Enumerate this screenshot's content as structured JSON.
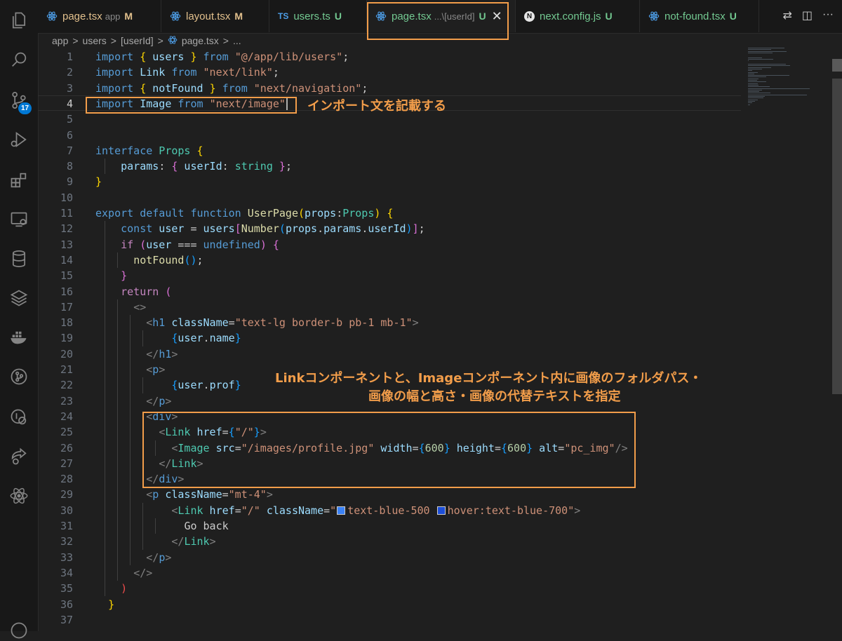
{
  "tabs": [
    {
      "label": "page.tsx",
      "desc": "app",
      "status": "M",
      "icon": "react-icon"
    },
    {
      "label": "layout.tsx",
      "desc": "",
      "status": "M",
      "icon": "react-icon"
    },
    {
      "label": "users.ts",
      "desc": "",
      "status": "U",
      "icon": "typescript-icon",
      "icon_text": "TS"
    },
    {
      "label": "page.tsx",
      "desc": "...\\[userId]",
      "status": "U",
      "icon": "react-icon",
      "active": true,
      "close": "✕"
    },
    {
      "label": "next.config.js",
      "desc": "",
      "status": "U",
      "icon": "nextjs-icon",
      "icon_text": "N"
    },
    {
      "label": "not-found.tsx",
      "desc": "",
      "status": "U",
      "icon": "react-icon"
    }
  ],
  "tab_actions": {
    "compare": "⇄",
    "split": "◫",
    "more": "···"
  },
  "breadcrumb": {
    "seg1": "app",
    "seg2": "users",
    "seg3": "[userId]",
    "file": "page.tsx",
    "tail": "...",
    "sep": ">"
  },
  "activity": {
    "scm_badge": "17"
  },
  "annotations": {
    "import_note": "インポート文を記載する",
    "link_note_1": "Linkコンポーネントと、Imageコンポーネント内に画像のフォルダパス・",
    "link_note_2": "画像の幅と高さ・画像の代替テキストを指定"
  },
  "lines": [
    [
      [
        "kw",
        "import"
      ],
      [
        "",
        "&nbsp;"
      ],
      [
        "br1",
        "{"
      ],
      [
        "id",
        " users "
      ],
      [
        "br1",
        "}"
      ],
      [
        "kw",
        " from "
      ],
      [
        "str",
        "\"@/app/lib/users\""
      ],
      [
        "",
        ";"
      ]
    ],
    [
      [
        "kw",
        "import"
      ],
      [
        "id",
        " Link"
      ],
      [
        "kw",
        " from "
      ],
      [
        "str",
        "\"next/link\""
      ],
      [
        "",
        ";"
      ]
    ],
    [
      [
        "kw",
        "import"
      ],
      [
        "",
        "&nbsp;"
      ],
      [
        "br1",
        "{"
      ],
      [
        "id",
        " notFound "
      ],
      [
        "br1",
        "}"
      ],
      [
        "kw",
        " from "
      ],
      [
        "str",
        "\"next/navigation\""
      ],
      [
        "",
        ";"
      ]
    ],
    [
      [
        "kw",
        "import"
      ],
      [
        "id",
        " Image"
      ],
      [
        "kw",
        " from "
      ],
      [
        "str",
        "\"next/image\""
      ]
    ],
    [],
    [],
    [
      [
        "kw",
        "interface"
      ],
      [
        "ty",
        " Props"
      ],
      [
        "br1",
        " {"
      ]
    ],
    [
      [
        "",
        "    "
      ],
      [
        "id",
        "params"
      ],
      [
        "",
        ": "
      ],
      [
        "br2",
        "{"
      ],
      [
        "id",
        " userId"
      ],
      [
        "",
        ": "
      ],
      [
        "ty",
        "string"
      ],
      [
        "br2",
        " }"
      ],
      [
        "",
        ";"
      ]
    ],
    [
      [
        "br1",
        "}"
      ]
    ],
    [],
    [
      [
        "kw",
        "export"
      ],
      [
        "kw",
        " default"
      ],
      [
        "kw",
        " function"
      ],
      [
        "fn",
        " UserPage"
      ],
      [
        "br1",
        "("
      ],
      [
        "id",
        "props"
      ],
      [
        "",
        ":"
      ],
      [
        "ty",
        "Props"
      ],
      [
        "br1",
        ")"
      ],
      [
        "br1",
        " {"
      ]
    ],
    [
      [
        "",
        "    "
      ],
      [
        "kw",
        "const"
      ],
      [
        "id",
        " user"
      ],
      [
        "",
        " = "
      ],
      [
        "id",
        "users"
      ],
      [
        "br2",
        "["
      ],
      [
        "fn",
        "Number"
      ],
      [
        "br3",
        "("
      ],
      [
        "id",
        "props"
      ],
      [
        "",
        "."
      ],
      [
        "id",
        "params"
      ],
      [
        "",
        "."
      ],
      [
        "id",
        "userId"
      ],
      [
        "br3",
        ")"
      ],
      [
        "br2",
        "]"
      ],
      [
        "",
        ";"
      ]
    ],
    [
      [
        "",
        "    "
      ],
      [
        "ctl",
        "if"
      ],
      [
        "br2",
        " ("
      ],
      [
        "id",
        "user"
      ],
      [
        "",
        " === "
      ],
      [
        "kw",
        "undefined"
      ],
      [
        "br2",
        ")"
      ],
      [
        "br2",
        " {"
      ]
    ],
    [
      [
        "",
        "      "
      ],
      [
        "fn",
        "notFound"
      ],
      [
        "br3",
        "()"
      ],
      [
        "",
        ";"
      ]
    ],
    [
      [
        "",
        "    "
      ],
      [
        "br2",
        "}"
      ]
    ],
    [
      [
        "",
        "    "
      ],
      [
        "ctl",
        "return"
      ],
      [
        "br2",
        " ("
      ]
    ],
    [
      [
        "",
        "      "
      ],
      [
        "pn",
        "<>"
      ]
    ],
    [
      [
        "",
        "        "
      ],
      [
        "pn",
        "<"
      ],
      [
        "kw",
        "h1"
      ],
      [
        "attr",
        " className"
      ],
      [
        "",
        "="
      ],
      [
        "str",
        "\"text-lg border-b pb-1 mb-1\""
      ],
      [
        "pn",
        ">"
      ]
    ],
    [
      [
        "",
        "            "
      ],
      [
        "br3",
        "{"
      ],
      [
        "id",
        "user"
      ],
      [
        "",
        "."
      ],
      [
        "id",
        "name"
      ],
      [
        "br3",
        "}"
      ]
    ],
    [
      [
        "",
        "        "
      ],
      [
        "pn",
        "</"
      ],
      [
        "kw",
        "h1"
      ],
      [
        "pn",
        ">"
      ]
    ],
    [
      [
        "",
        "        "
      ],
      [
        "pn",
        "<"
      ],
      [
        "kw",
        "p"
      ],
      [
        "pn",
        ">"
      ]
    ],
    [
      [
        "",
        "            "
      ],
      [
        "br3",
        "{"
      ],
      [
        "id",
        "user"
      ],
      [
        "",
        "."
      ],
      [
        "id",
        "prof"
      ],
      [
        "br3",
        "}"
      ]
    ],
    [
      [
        "",
        "        "
      ],
      [
        "pn",
        "</"
      ],
      [
        "kw",
        "p"
      ],
      [
        "pn",
        ">"
      ]
    ],
    [
      [
        "",
        "        "
      ],
      [
        "pn",
        "<"
      ],
      [
        "kw",
        "div"
      ],
      [
        "pn",
        ">"
      ]
    ],
    [
      [
        "",
        "          "
      ],
      [
        "pn",
        "<"
      ],
      [
        "tag",
        "Link"
      ],
      [
        "attr",
        " href"
      ],
      [
        "",
        "="
      ],
      [
        "br3",
        "{"
      ],
      [
        "str",
        "\"/\""
      ],
      [
        "br3",
        "}"
      ],
      [
        "pn",
        ">"
      ]
    ],
    [
      [
        "",
        "            "
      ],
      [
        "pn",
        "<"
      ],
      [
        "tag",
        "Image"
      ],
      [
        "attr",
        " src"
      ],
      [
        "",
        "="
      ],
      [
        "str",
        "\"/images/profile.jpg\""
      ],
      [
        "attr",
        " width"
      ],
      [
        "",
        "="
      ],
      [
        "br3",
        "{"
      ],
      [
        "num",
        "600"
      ],
      [
        "br3",
        "}"
      ],
      [
        "attr",
        " height"
      ],
      [
        "",
        "="
      ],
      [
        "br3",
        "{"
      ],
      [
        "num",
        "600"
      ],
      [
        "br3",
        "}"
      ],
      [
        "attr",
        " alt"
      ],
      [
        "",
        "="
      ],
      [
        "str",
        "\"pc_img\""
      ],
      [
        "pn",
        "/>"
      ]
    ],
    [
      [
        "",
        "          "
      ],
      [
        "pn",
        "</"
      ],
      [
        "tag",
        "Link"
      ],
      [
        "pn",
        ">"
      ]
    ],
    [
      [
        "",
        "        "
      ],
      [
        "pn",
        "</"
      ],
      [
        "kw",
        "div"
      ],
      [
        "pn",
        ">"
      ]
    ],
    [
      [
        "",
        "        "
      ],
      [
        "pn",
        "<"
      ],
      [
        "kw",
        "p"
      ],
      [
        "attr",
        " className"
      ],
      [
        "",
        "="
      ],
      [
        "str",
        "\"mt-4\""
      ],
      [
        "pn",
        ">"
      ]
    ],
    [
      [
        "",
        "            "
      ],
      [
        "pn",
        "<"
      ],
      [
        "tag",
        "Link"
      ],
      [
        "attr",
        " href"
      ],
      [
        "",
        "="
      ],
      [
        "str",
        "\"/\""
      ],
      [
        "attr",
        " className"
      ],
      [
        "",
        "="
      ],
      [
        "str",
        "\""
      ],
      [
        "sw1",
        ""
      ],
      [
        "str",
        "text-blue-500 "
      ],
      [
        "sw2",
        ""
      ],
      [
        "str",
        "hover:text-blue-700\""
      ],
      [
        "pn",
        ">"
      ]
    ],
    [
      [
        "",
        "              "
      ],
      [
        "",
        "Go back"
      ]
    ],
    [
      [
        "",
        "            "
      ],
      [
        "pn",
        "</"
      ],
      [
        "tag",
        "Link"
      ],
      [
        "pn",
        ">"
      ]
    ],
    [
      [
        "",
        "        "
      ],
      [
        "pn",
        "</"
      ],
      [
        "kw",
        "p"
      ],
      [
        "pn",
        ">"
      ]
    ],
    [
      [
        "",
        "      "
      ],
      [
        "pn",
        "</>"
      ]
    ],
    [
      [
        "",
        "    "
      ],
      [
        "err",
        ")"
      ]
    ],
    [
      [
        "",
        "  "
      ],
      [
        "br1",
        "}"
      ]
    ],
    []
  ]
}
